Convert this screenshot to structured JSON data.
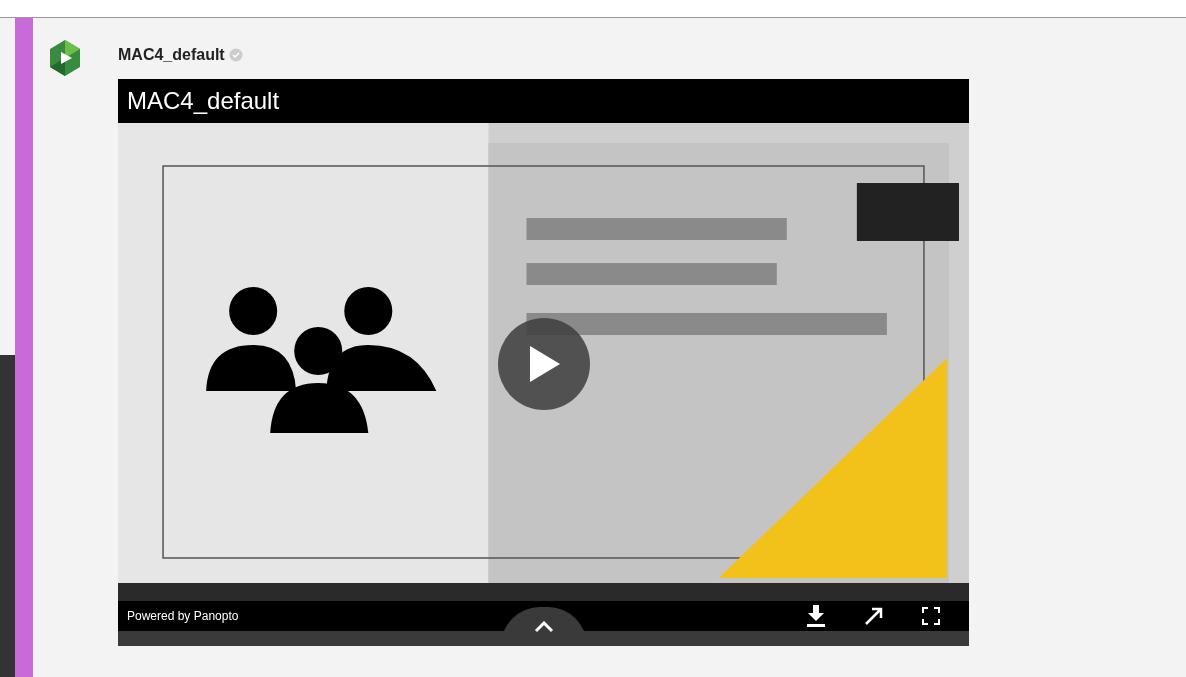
{
  "post": {
    "title": "MAC4_default"
  },
  "player": {
    "title": "MAC4_default",
    "footer": "Powered by Panopto"
  }
}
